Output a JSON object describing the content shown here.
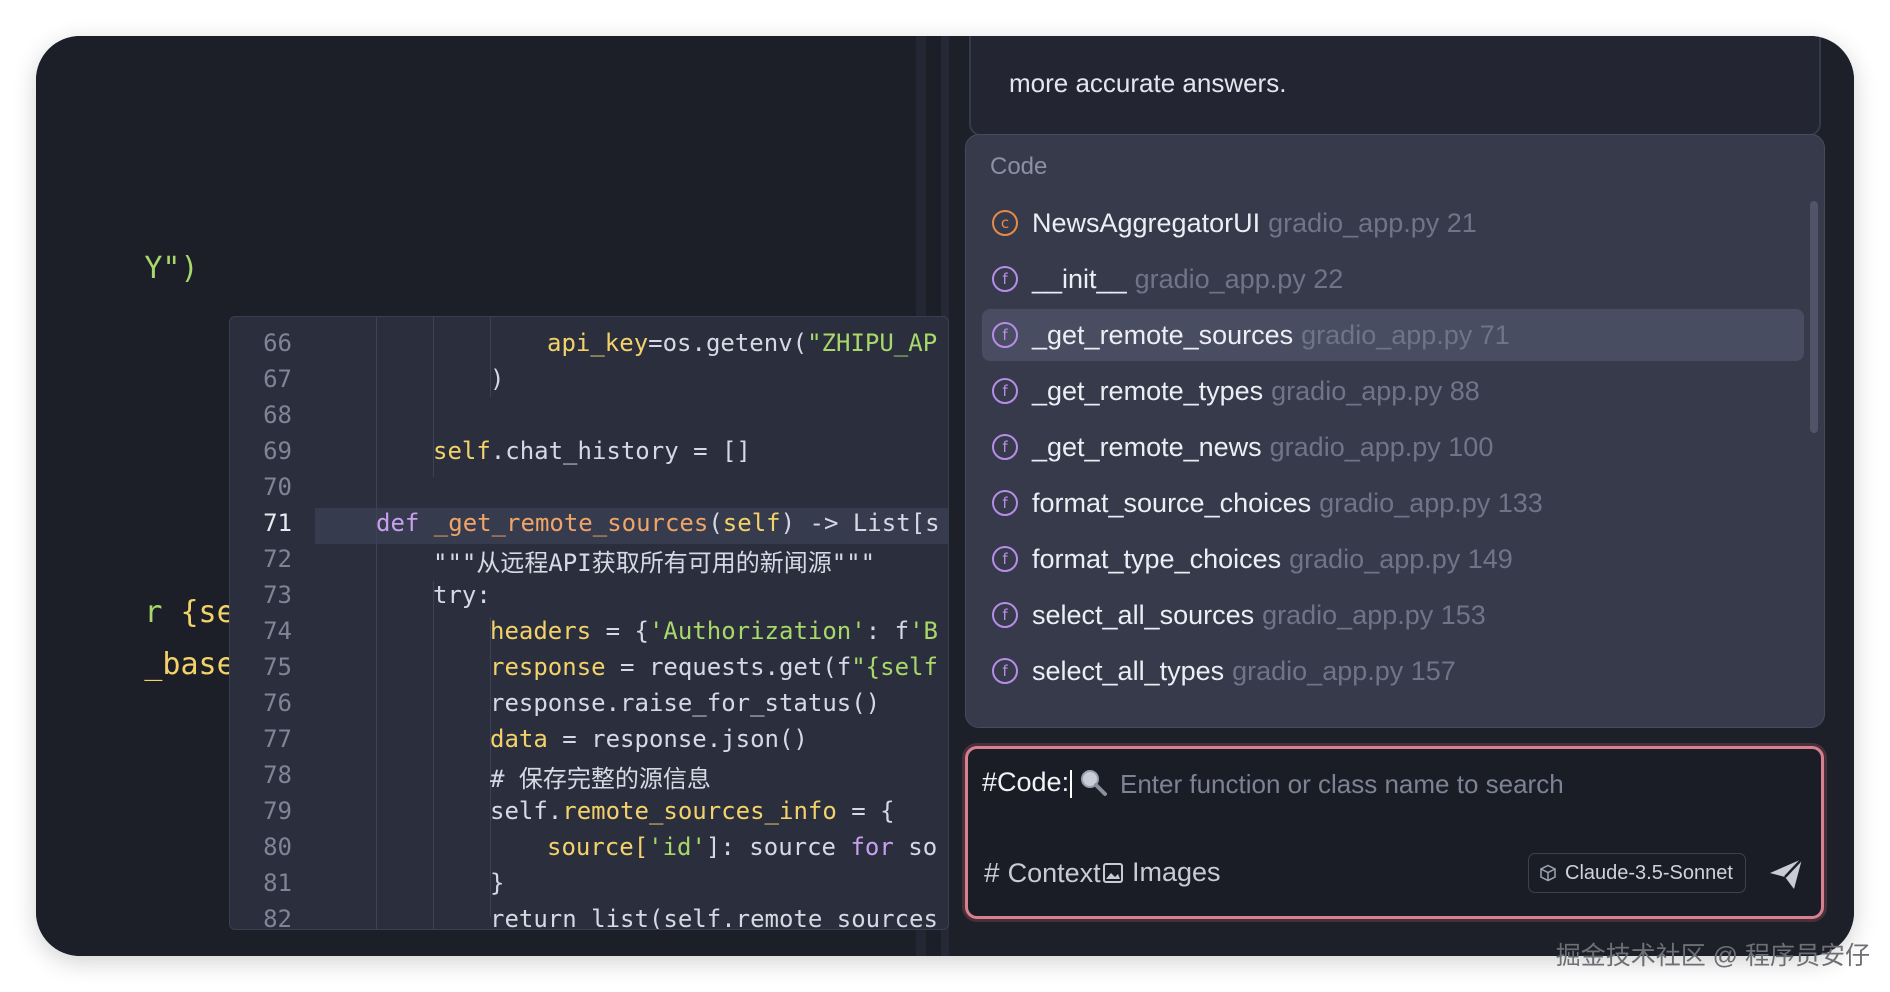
{
  "editor_bg": {
    "line1": "Y\")",
    "line2_a": "r ",
    "line2_b": "{self.api",
    "line3_a": "_base_url",
    "line3_b": "}/"
  },
  "peek": {
    "line_numbers": [
      "66",
      "67",
      "68",
      "69",
      "70",
      "71",
      "72",
      "73",
      "74",
      "75",
      "76",
      "77",
      "78",
      "79",
      "80",
      "81",
      "82"
    ],
    "active_line": "71",
    "code": {
      "l66_a": "api_key",
      "l66_b": "=os.getenv(",
      "l66_c": "\"ZHIPU_AP",
      "l67": ")",
      "l69_a": "self",
      "l69_b": ".chat_history = []",
      "l71_a": "def ",
      "l71_b": "_get_remote_sources",
      "l71_c": "(",
      "l71_d": "self",
      "l71_e": ") -> List[s",
      "l72": "\"\"\"从远程API获取所有可用的新闻源\"\"\"",
      "l73": "try:",
      "l74_a": "headers",
      "l74_b": " = {",
      "l74_c": "'Authorization'",
      "l74_d": ": f",
      "l74_e": "'B",
      "l75_a": "response",
      "l75_b": " = requests.get(f",
      "l75_c": "\"{self",
      "l76": "response.raise_for_status()",
      "l77_a": "data",
      "l77_b": " = response.json()",
      "l78": "# 保存完整的源信息",
      "l79_a": "self.",
      "l79_b": "remote_sources_info",
      "l79_c": " = {",
      "l80_a": "source[",
      "l80_b": "'id'",
      "l80_c": "]: source ",
      "l80_d": "for",
      "l80_e": " so",
      "l81": "}",
      "l82": "return list(self.remote_sources"
    }
  },
  "chat": {
    "bubble_text": "more accurate answers."
  },
  "dropdown": {
    "title": "Code",
    "selected_index": 2,
    "items": [
      {
        "icon": "class-icon",
        "glyph": "c",
        "name": "NewsAggregatorUI",
        "meta": "gradio_app.py 21"
      },
      {
        "icon": "function-icon",
        "glyph": "f",
        "name": "__init__",
        "meta": "gradio_app.py 22"
      },
      {
        "icon": "function-icon",
        "glyph": "f",
        "name": "_get_remote_sources",
        "meta": "gradio_app.py 71"
      },
      {
        "icon": "function-icon",
        "glyph": "f",
        "name": "_get_remote_types",
        "meta": "gradio_app.py 88"
      },
      {
        "icon": "function-icon",
        "glyph": "f",
        "name": "_get_remote_news",
        "meta": "gradio_app.py 100"
      },
      {
        "icon": "function-icon",
        "glyph": "f",
        "name": "format_source_choices",
        "meta": "gradio_app.py 133"
      },
      {
        "icon": "function-icon",
        "glyph": "f",
        "name": "format_type_choices",
        "meta": "gradio_app.py 149"
      },
      {
        "icon": "function-icon",
        "glyph": "f",
        "name": "select_all_sources",
        "meta": "gradio_app.py 153"
      },
      {
        "icon": "function-icon",
        "glyph": "f",
        "name": "select_all_types",
        "meta": "gradio_app.py 157"
      }
    ]
  },
  "input": {
    "prefix": "#Code:",
    "value": "",
    "placeholder": "Enter function or class name to search",
    "context_label": "Context",
    "images_label": "Images",
    "model_label": "Claude-3.5-Sonnet"
  },
  "watermark": "掘金技术社区 @ 程序员安仔",
  "colors": {
    "window_bg": "#1d1f28",
    "dropdown_bg": "#363a4b",
    "selected_bg": "#484d62",
    "input_border": "#d9808e",
    "function_icon": "#b98ce8",
    "class_icon": "#e68a4a"
  }
}
